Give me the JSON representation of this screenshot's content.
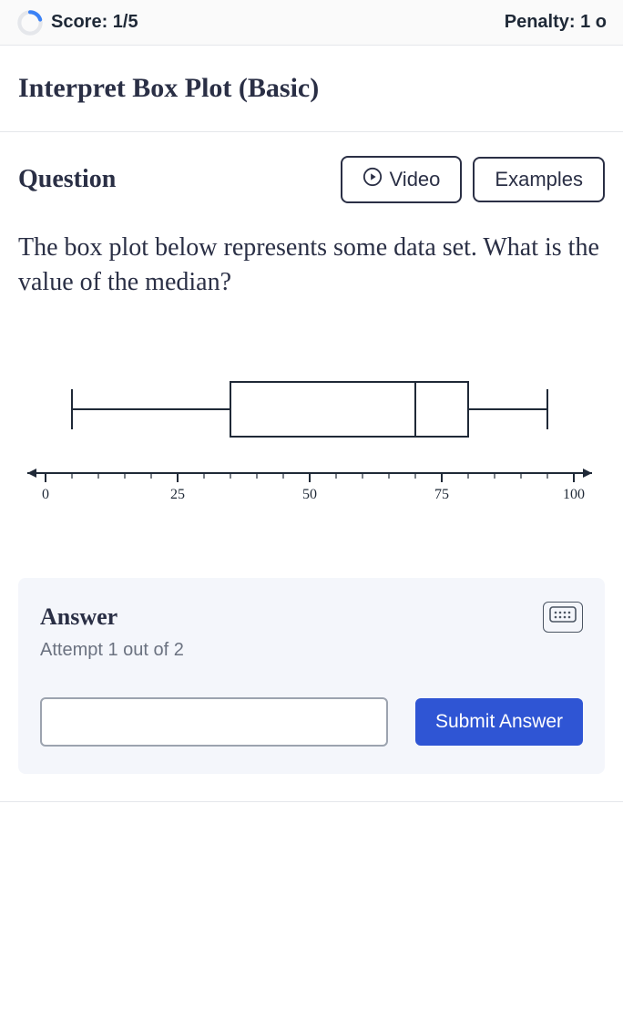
{
  "topbar": {
    "score_label": "Score: 1/5",
    "penalty_label": "Penalty: 1 o"
  },
  "title": "Interpret Box Plot (Basic)",
  "question": {
    "heading": "Question",
    "video_label": "Video",
    "examples_label": "Examples",
    "prompt": "The box plot below represents some data set. What is the value of the median?"
  },
  "chart_data": {
    "type": "boxplot",
    "xlabel": "",
    "xlim": [
      0,
      100
    ],
    "ticks": [
      0,
      25,
      50,
      75,
      100
    ],
    "min": 5,
    "q1": 35,
    "median": 70,
    "q3": 80,
    "max": 95
  },
  "answer": {
    "heading": "Answer",
    "attempt_text": "Attempt 1 out of 2",
    "input_value": "",
    "submit_label": "Submit Answer"
  }
}
